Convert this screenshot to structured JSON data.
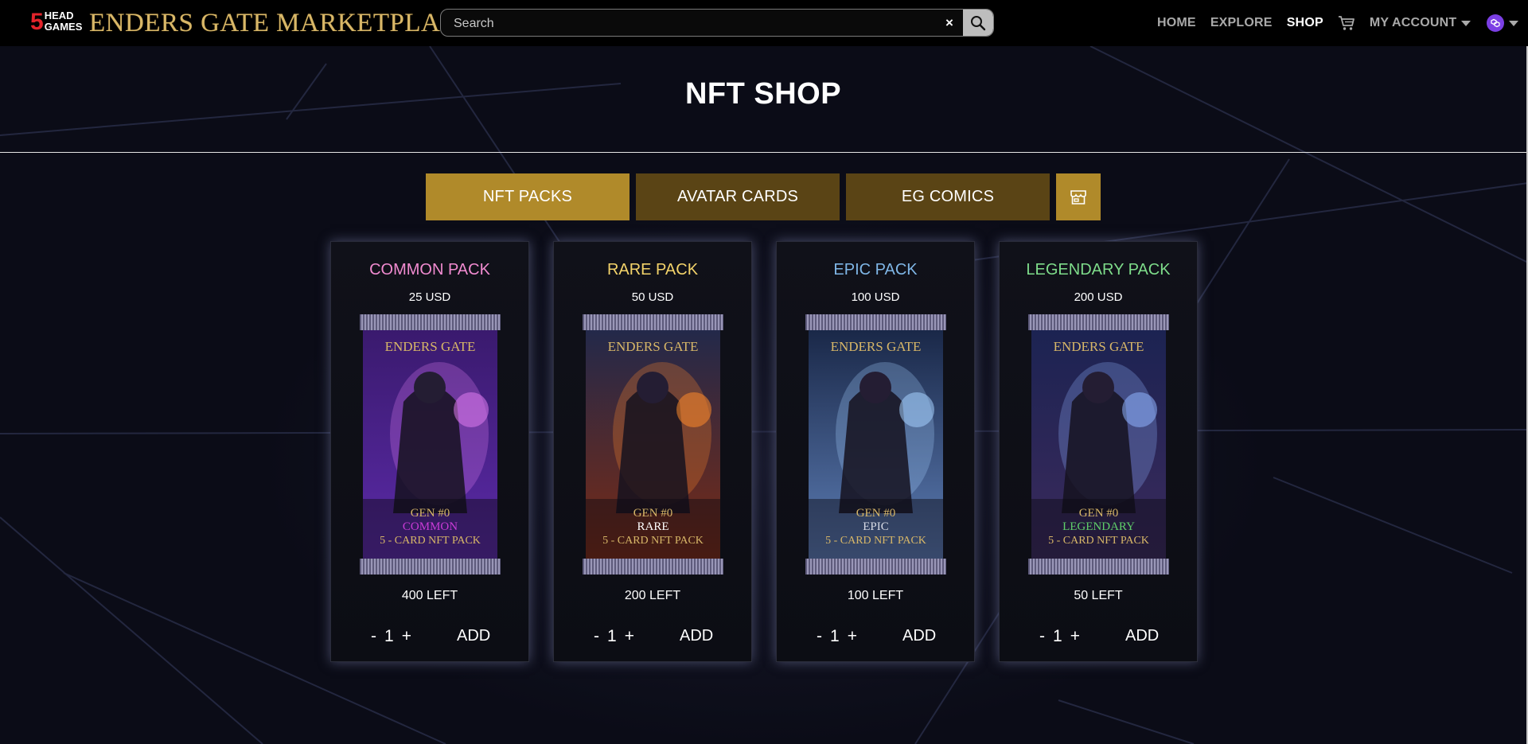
{
  "navbar": {
    "logo_number": "5",
    "logo_line1": "HEAD",
    "logo_line2": "GAMES",
    "brand": "ENDERS GATE MARKETPLACE",
    "search_placeholder": "Search",
    "clear_symbol": "×",
    "links": [
      {
        "label": "HOME",
        "active": false
      },
      {
        "label": "EXPLORE",
        "active": false
      },
      {
        "label": "SHOP",
        "active": true
      }
    ],
    "account_label": "MY ACCOUNT"
  },
  "page": {
    "title": "NFT SHOP"
  },
  "tabs": [
    {
      "label": "NFT PACKS",
      "active": true
    },
    {
      "label": "AVATAR CARDS",
      "active": false
    },
    {
      "label": "EG COMICS",
      "active": false
    }
  ],
  "packs": [
    {
      "title": "COMMON PACK",
      "title_color": "#f18bd0",
      "price": "25 USD",
      "art_brand": "ENDERS GATE",
      "art_gen": "GEN #0",
      "art_tier": "COMMON",
      "art_tier_color": "#c93bd6",
      "art_desc": "5 - CARD NFT PACK",
      "art_bg_top": "#3a1a6e",
      "art_bg_bottom": "#5b2aa8",
      "art_accent": "#e07cf0",
      "left": "400 LEFT",
      "qty_minus": "-",
      "qty": "1",
      "qty_plus": "+",
      "add": "ADD"
    },
    {
      "title": "RARE PACK",
      "title_color": "#f3d36a",
      "price": "50 USD",
      "art_brand": "ENDERS GATE",
      "art_gen": "GEN #0",
      "art_tier": "RARE",
      "art_tier_color": "#ffffff",
      "art_desc": "5 - CARD NFT PACK",
      "art_bg_top": "#23294a",
      "art_bg_bottom": "#7a2a14",
      "art_accent": "#ff8a2a",
      "left": "200 LEFT",
      "qty_minus": "-",
      "qty": "1",
      "qty_plus": "+",
      "add": "ADD"
    },
    {
      "title": "EPIC PACK",
      "title_color": "#7fb6e6",
      "price": "100 USD",
      "art_brand": "ENDERS GATE",
      "art_gen": "GEN #0",
      "art_tier": "EPIC",
      "art_tier_color": "#d8dbe6",
      "art_desc": "5 - CARD NFT PACK",
      "art_bg_top": "#1a2848",
      "art_bg_bottom": "#5d7eb6",
      "art_accent": "#a6d2ff",
      "left": "100 LEFT",
      "qty_minus": "-",
      "qty": "1",
      "qty_plus": "+",
      "add": "ADD"
    },
    {
      "title": "LEGENDARY PACK",
      "title_color": "#7edc8a",
      "price": "200 USD",
      "art_brand": "ENDERS GATE",
      "art_gen": "GEN #0",
      "art_tier": "LEGENDARY",
      "art_tier_color": "#5fcf6a",
      "art_desc": "5 - CARD NFT PACK",
      "art_bg_top": "#1c2352",
      "art_bg_bottom": "#3b2a5c",
      "art_accent": "#8fb4ff",
      "left": "50 LEFT",
      "qty_minus": "-",
      "qty": "1",
      "qty_plus": "+",
      "add": "ADD"
    }
  ],
  "colors": {
    "gold_active": "#b08a2a",
    "gold_dark": "#5a4415",
    "brand_gold": "#d8b768",
    "wallet_purple": "#7b3fe4"
  }
}
